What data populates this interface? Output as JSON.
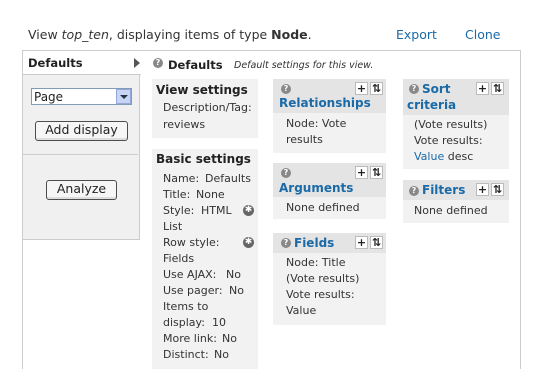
{
  "header": {
    "view_prefix": "View ",
    "view_name": "top_ten",
    "middle": ", displaying items of type ",
    "type_name": "Node",
    "suffix": ".",
    "export_label": "Export",
    "clone_label": "Clone"
  },
  "left": {
    "tab_label": "Defaults",
    "select_value": "Page",
    "add_display_label": "Add display",
    "analyze_label": "Analyze"
  },
  "main": {
    "title": "Defaults",
    "description": "Default settings for this view."
  },
  "view_settings": {
    "title": "View settings",
    "desc_label": "Description/Tag:",
    "desc_value": "reviews"
  },
  "basic_settings": {
    "title": "Basic settings",
    "name_label": "Name:",
    "name_value": "Defaults",
    "title_label": "Title:",
    "title_value": "None",
    "style_label": "Style:",
    "style_value_1": "HTML",
    "style_value_2": "List",
    "row_style_label": "Row style:",
    "row_style_value": "Fields",
    "ajax_label": "Use AJAX:",
    "ajax_value": "No",
    "pager_label": "Use pager:",
    "pager_value": "No",
    "items_label_1": "Items to",
    "items_label_2": "display:",
    "items_value": "10",
    "more_label": "More link:",
    "more_value": "No",
    "distinct_label": "Distinct:",
    "distinct_value": "No"
  },
  "relationships": {
    "title": "Relationships",
    "line1": "Node: Vote",
    "line2": "results"
  },
  "arguments": {
    "title": "Arguments",
    "empty": "None defined"
  },
  "fields": {
    "title": "Fields",
    "line1": "Node: Title",
    "line2": "(Vote results)",
    "line3": "Vote results:",
    "line4": "Value"
  },
  "sort": {
    "title_1": "Sort",
    "title_2": "criteria",
    "line1": "(Vote results)",
    "line2": "Vote results:",
    "line3": "Value",
    "line3_suffix": " desc"
  },
  "filters": {
    "title": "Filters",
    "empty": "None defined"
  },
  "icons": {
    "help": "?",
    "add": "+",
    "rearrange": "⇅",
    "gear": "✱"
  }
}
